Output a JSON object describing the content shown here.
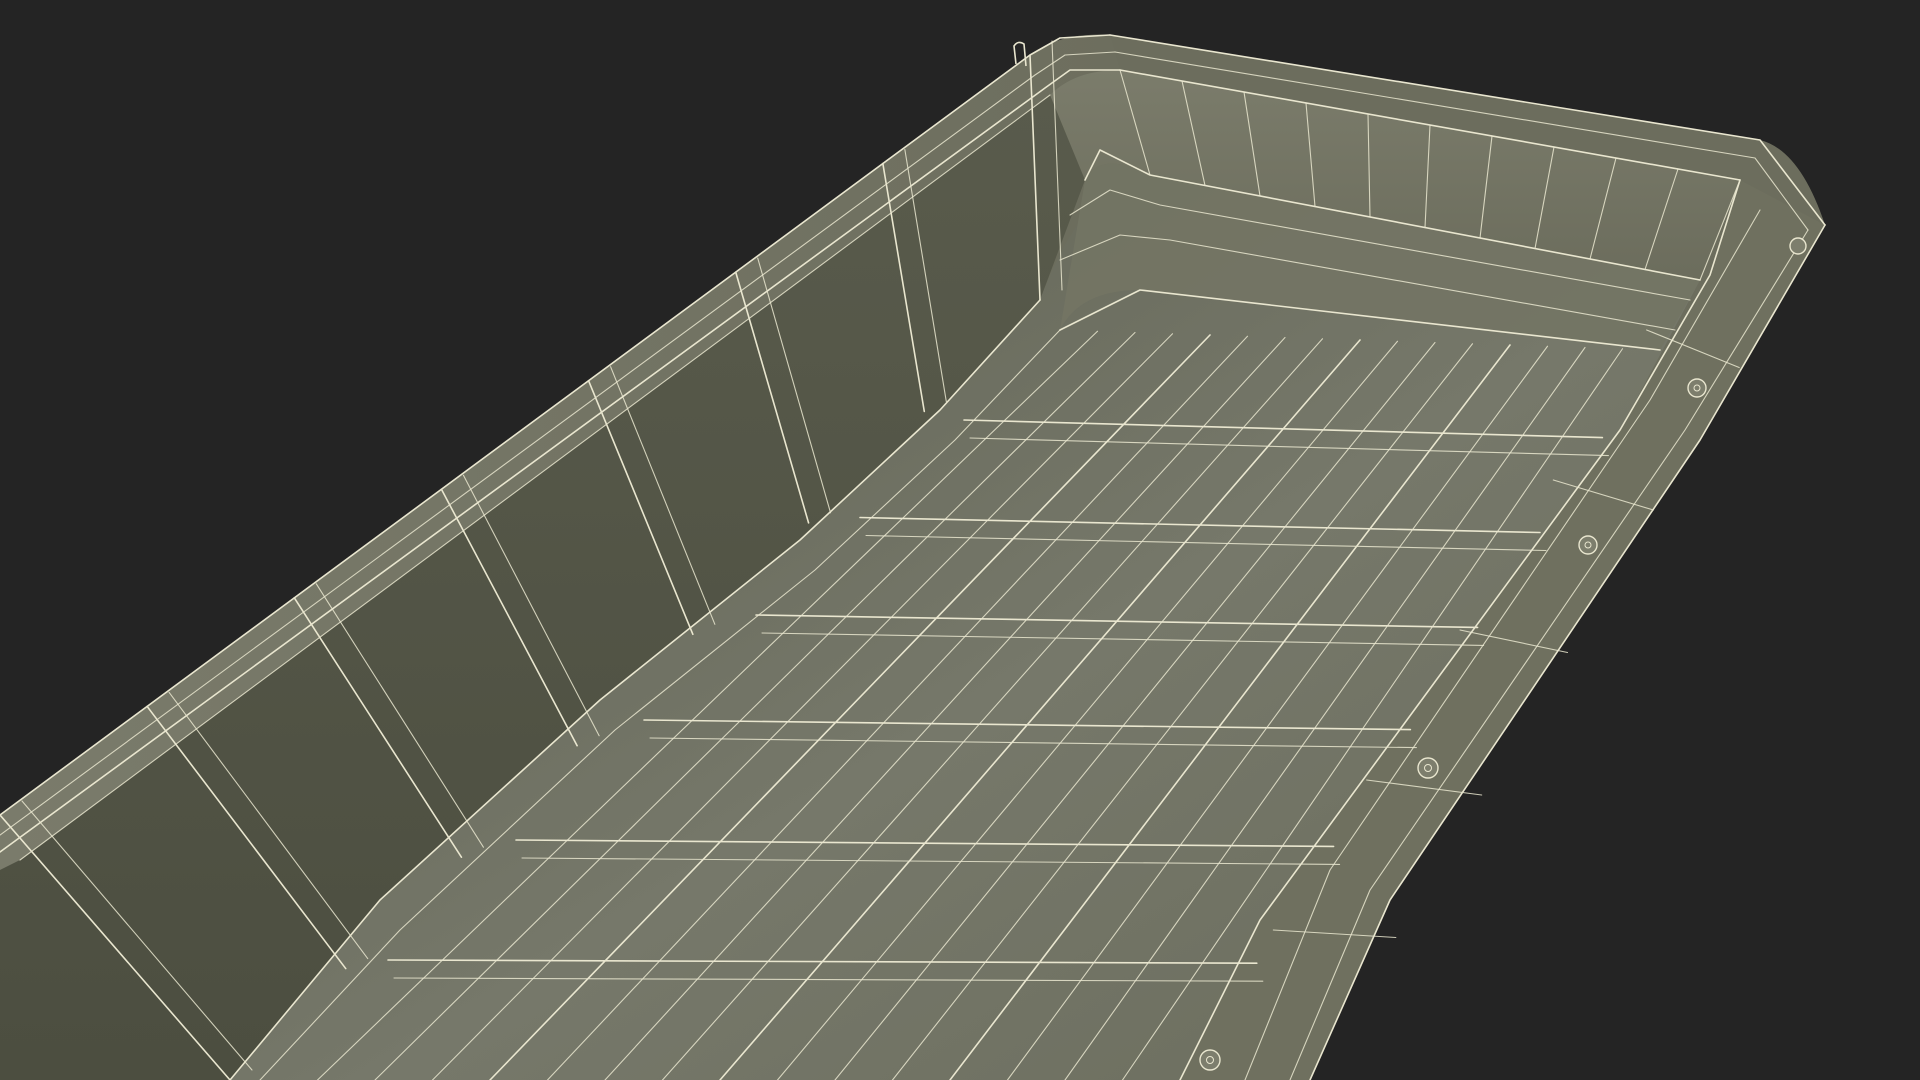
{
  "scene": {
    "background_color": "#242424",
    "shell_color": "#6e6f5f",
    "shell_dark_color": "#565849",
    "floor_color": "#717262",
    "wire_color": "#e9e6cf",
    "render_mode": "wireframe-on-shaded",
    "subject": "sled-tub-3d-model"
  }
}
